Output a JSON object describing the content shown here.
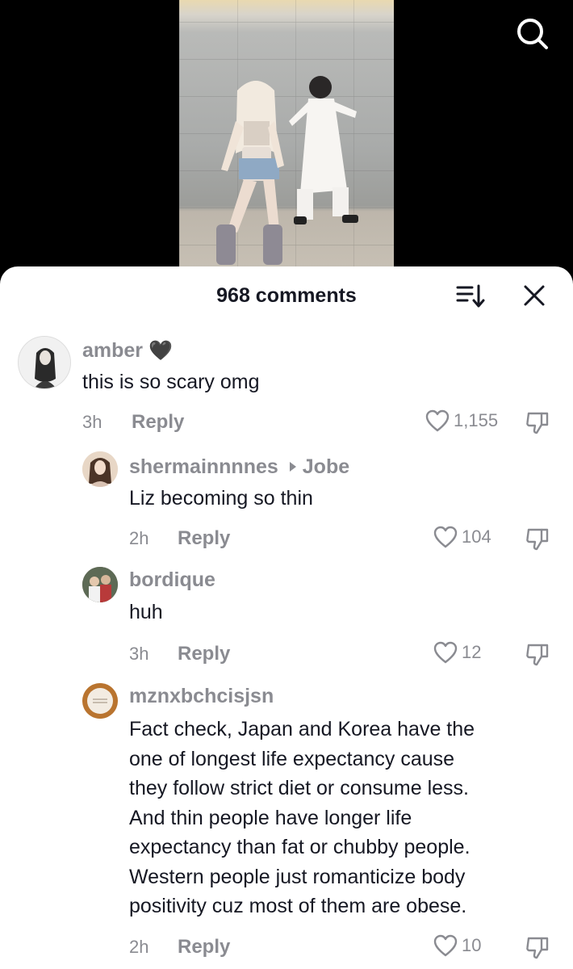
{
  "video": {
    "search_icon": "search-icon"
  },
  "sheet": {
    "title": "968 comments",
    "sort_icon": "sort-icon",
    "close_icon": "close-icon"
  },
  "comments": [
    {
      "username": "amber",
      "username_emoji": "🖤",
      "text": "this is so scary omg",
      "time": "3h",
      "reply_label": "Reply",
      "likes": "1,155"
    },
    {
      "username": "shermainnnnes",
      "reply_to": "Jobe",
      "text": "Liz becoming so thin",
      "time": "2h",
      "reply_label": "Reply",
      "likes": "104"
    },
    {
      "username": "bordique",
      "text": "huh",
      "time": "3h",
      "reply_label": "Reply",
      "likes": "12"
    },
    {
      "username": "mznxbchcisjsn",
      "text_lines": [
        "Fact check, Japan and Korea have the",
        "one of longest life expectancy cause",
        "they follow strict diet or consume less.",
        "And thin people have longer life",
        "expectancy than fat or chubby people.",
        "Western people just romanticize body",
        "positivity cuz most of them are obese."
      ],
      "time": "2h",
      "reply_label": "Reply",
      "likes": "10"
    }
  ]
}
